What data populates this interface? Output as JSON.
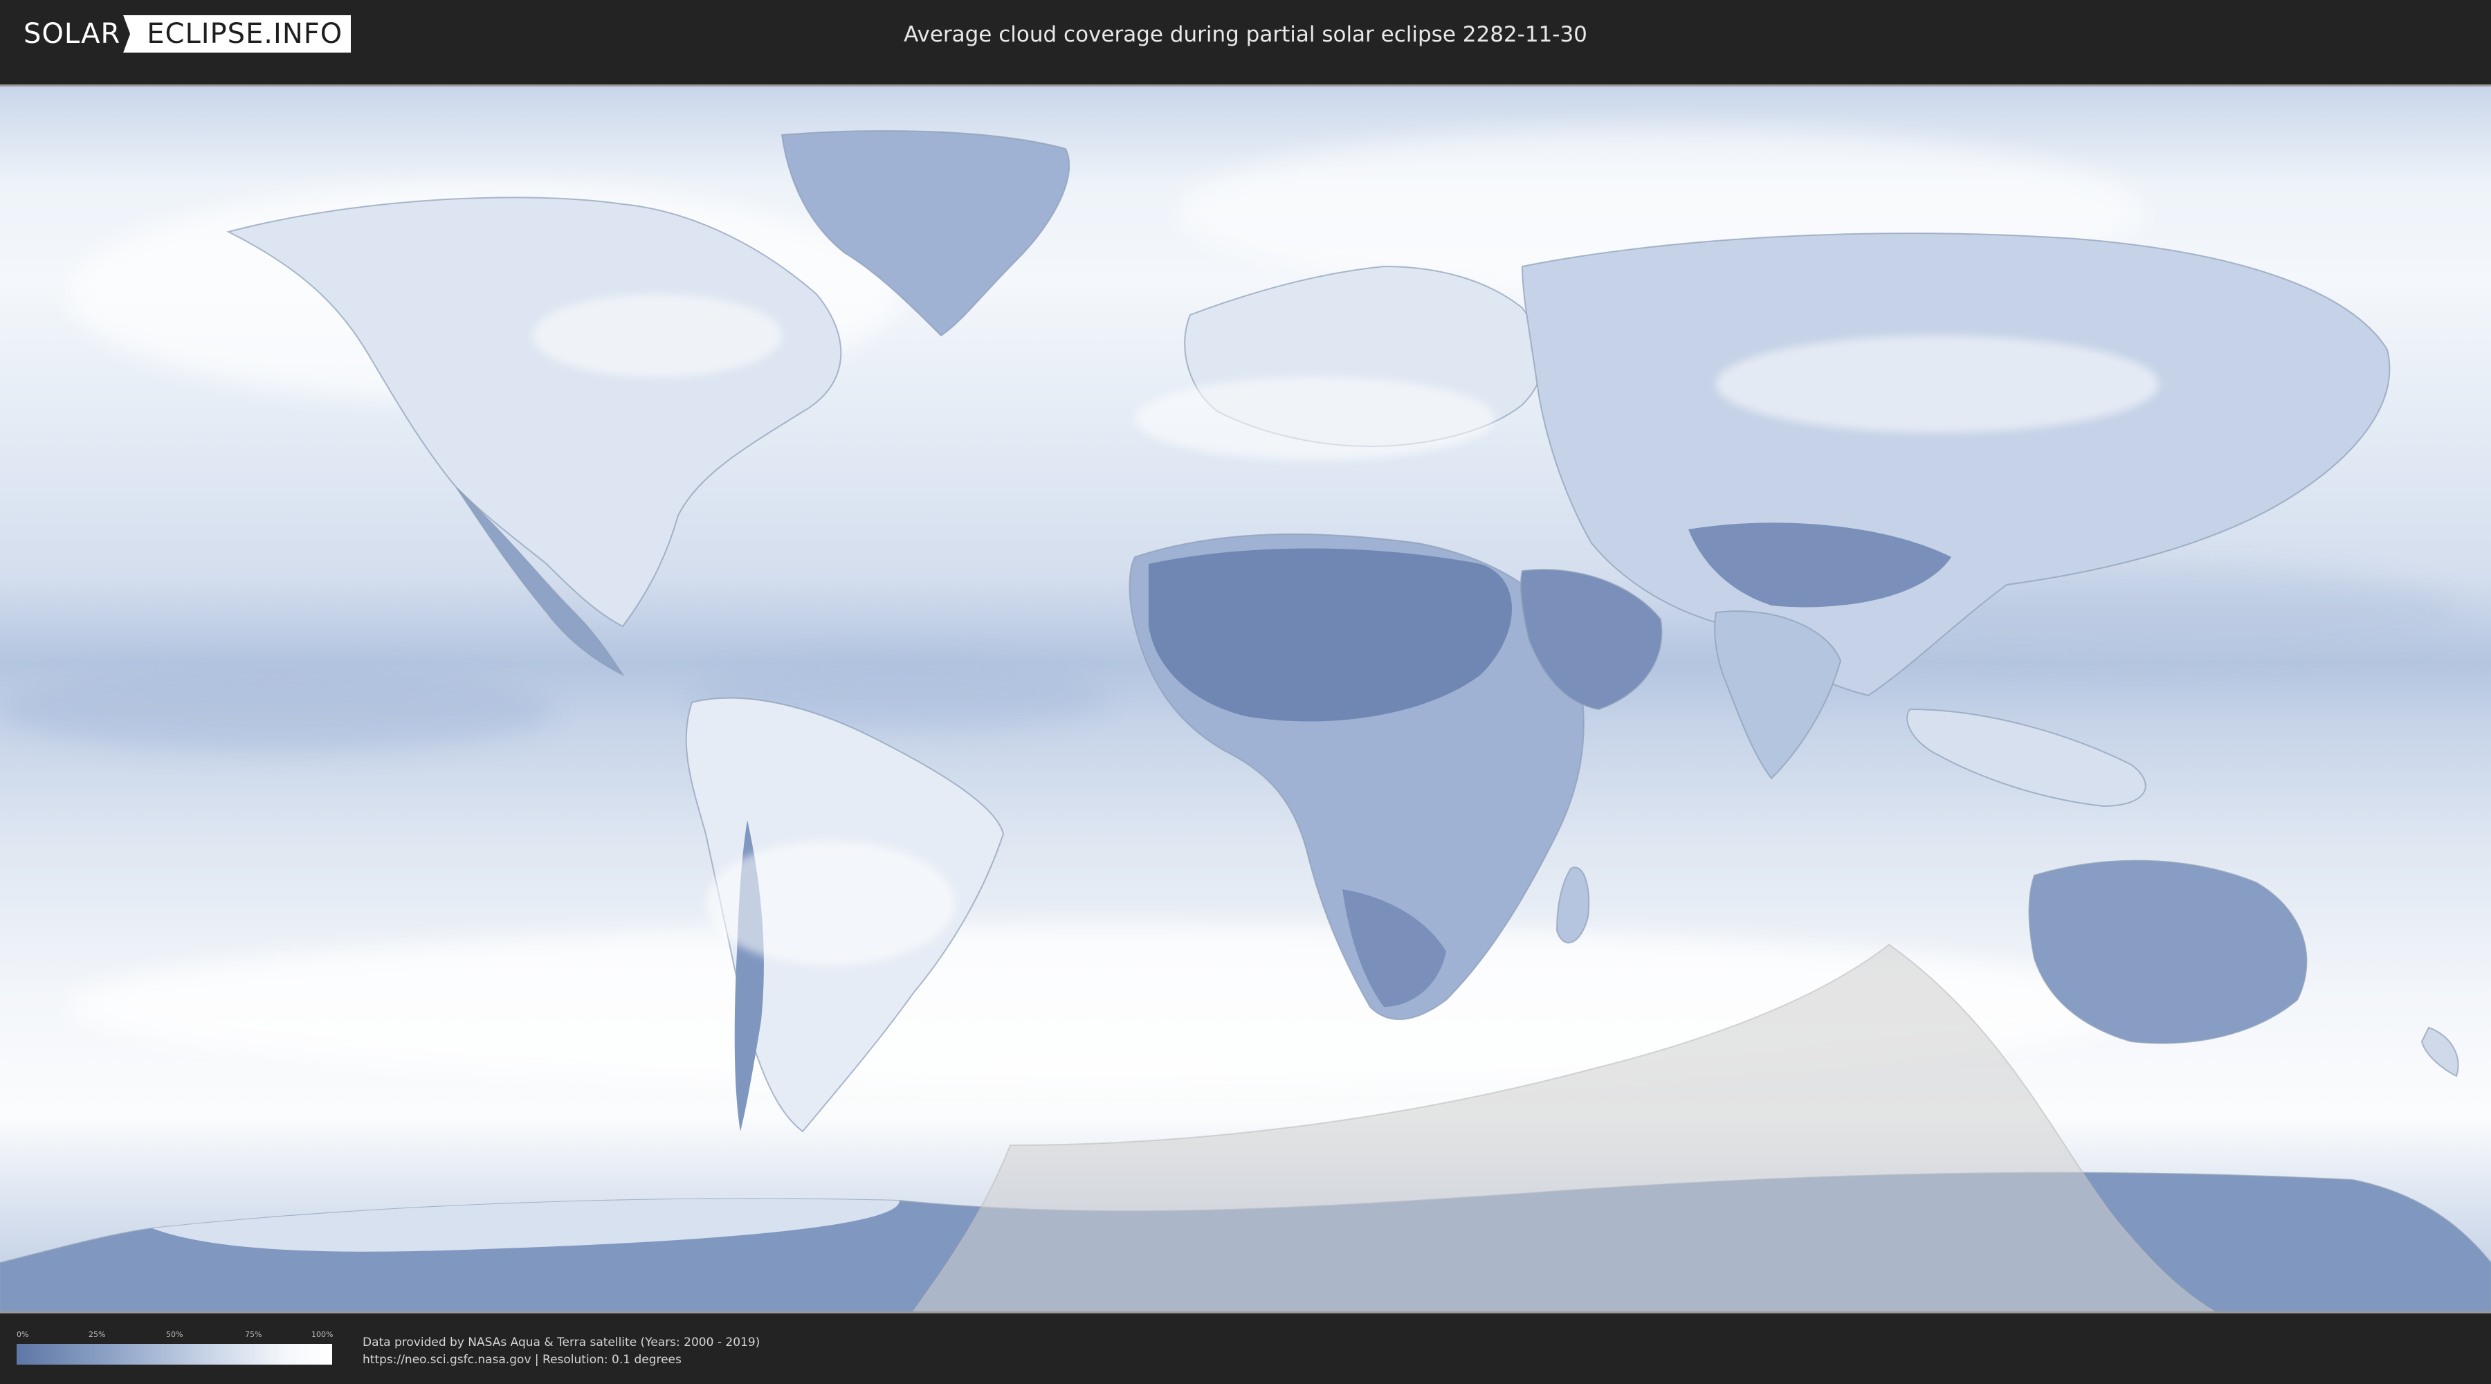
{
  "header": {
    "logo_left": "SOLAR",
    "logo_right": "ECLIPSE.INFO",
    "title": "Average cloud coverage during partial solar eclipse 2282-11-30"
  },
  "map": {
    "layer": "cloud coverage",
    "eclipse_zone": "partial solar eclipse visibility area",
    "colors": {
      "clear": "#5e77a6",
      "cloudy": "#ffffff",
      "eclipse_overlay": "#cfcfcf"
    }
  },
  "legend": {
    "ticks": [
      "0%",
      "25%",
      "50%",
      "75%",
      "100%"
    ],
    "gradient_from": "#5e77a6",
    "gradient_to": "#ffffff"
  },
  "footer": {
    "credit_line": "Data provided by NASAs Aqua & Terra satellite (Years: 2000 - 2019)",
    "source_line": "https://neo.sci.gsfc.nasa.gov | Resolution: 0.1 degrees"
  }
}
